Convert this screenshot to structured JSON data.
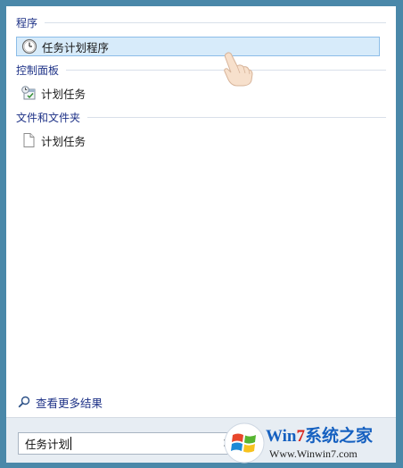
{
  "sections": {
    "programs": {
      "header": "程序",
      "items": [
        {
          "label": "任务计划程序",
          "icon": "clock-icon",
          "selected": true
        }
      ]
    },
    "control_panel": {
      "header": "控制面板",
      "items": [
        {
          "label": "计划任务",
          "icon": "scheduled-tasks-icon"
        }
      ]
    },
    "files": {
      "header": "文件和文件夹",
      "items": [
        {
          "label": "计划任务",
          "icon": "document-icon"
        }
      ]
    }
  },
  "see_more": {
    "label": "查看更多结果",
    "icon": "search-icon"
  },
  "search": {
    "value": "任务计划",
    "clear_icon": "clear-icon",
    "clear_glyph": "✕"
  },
  "watermark": {
    "brand_part1": "Win",
    "brand_part2": "7",
    "brand_part3": "系统之家",
    "url": "Www.Winwin7.com",
    "logo": "windows-logo"
  },
  "colors": {
    "frame": "#4a88a9",
    "header_text": "#1e3287",
    "selection_bg": "#d7ebfa",
    "selection_border": "#8cbde8",
    "brand_blue": "#1560c0",
    "brand_red": "#d8241c"
  }
}
